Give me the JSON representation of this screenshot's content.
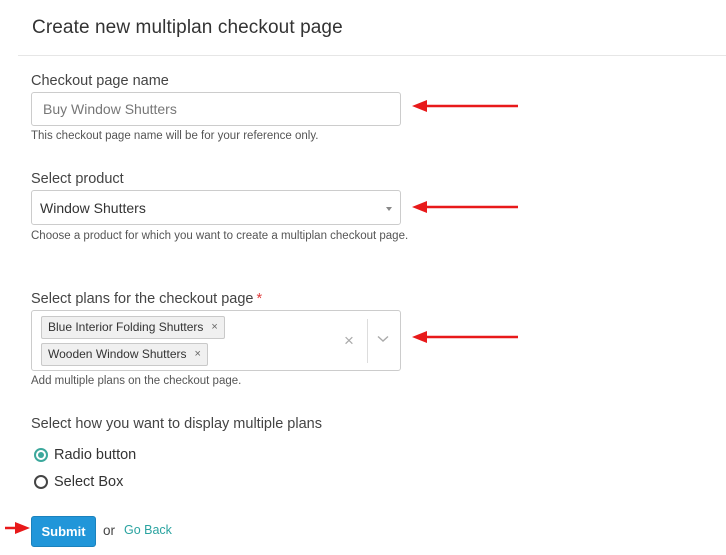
{
  "header": {
    "title": "Create new multiplan checkout page"
  },
  "checkout_name": {
    "label": "Checkout page name",
    "value": "",
    "placeholder": "Buy Window Shutters",
    "help": "This checkout page name will be for your reference only."
  },
  "product": {
    "label": "Select product",
    "value": "Window Shutters",
    "help": "Choose a product for which you want to create a multiplan checkout page."
  },
  "plans": {
    "label": "Select plans for the checkout page",
    "required_mark": "*",
    "selected": [
      "Blue Interior Folding Shutters",
      "Wooden Window Shutters"
    ],
    "remove_glyph": "×",
    "clear_glyph": "×",
    "help": "Add multiple plans on the checkout page."
  },
  "display": {
    "label": "Select how you want to display multiple plans",
    "options": [
      {
        "label": "Radio button",
        "selected": true
      },
      {
        "label": "Select Box",
        "selected": false
      }
    ]
  },
  "actions": {
    "submit_label": "Submit",
    "or_text": "or",
    "back_label": "Go Back"
  },
  "colors": {
    "accent": "#2196d9",
    "link": "#2aa3a0",
    "radio_active": "#3ca89c",
    "annotation_arrow": "#e8191a",
    "required": "#e03a3a"
  }
}
